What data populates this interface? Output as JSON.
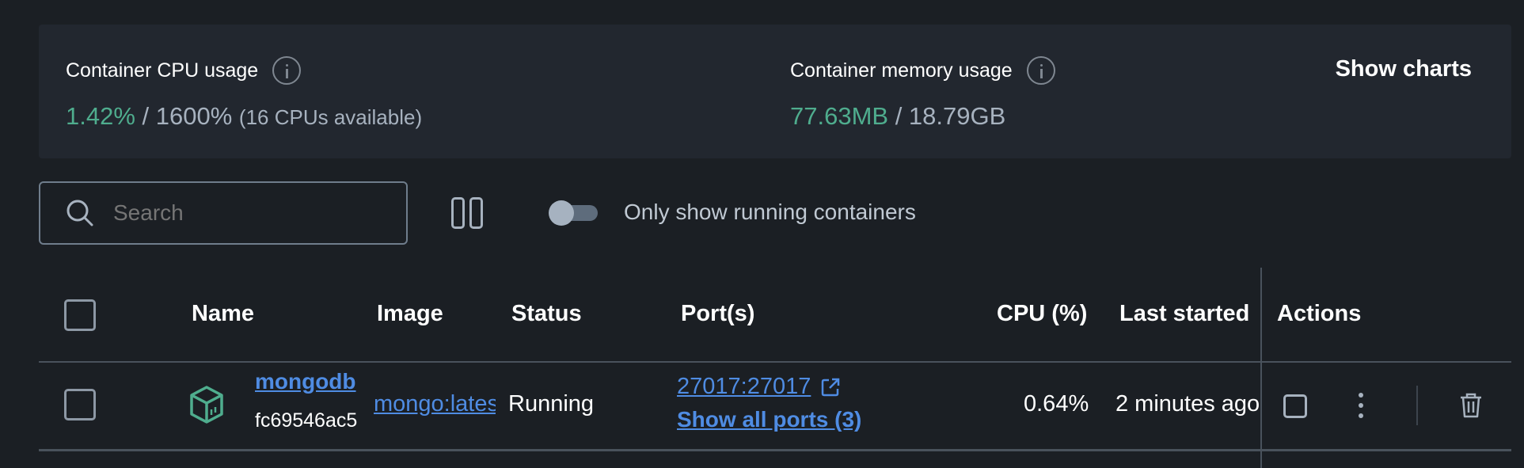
{
  "stats": {
    "cpu": {
      "label": "Container CPU usage",
      "used": "1.42%",
      "separator": " / ",
      "total": "1600%",
      "note": "(16 CPUs available)"
    },
    "memory": {
      "label": "Container memory usage",
      "used": "77.63MB",
      "separator": " / ",
      "total": "18.79GB"
    },
    "show_charts_label": "Show charts"
  },
  "toolbar": {
    "search_placeholder": "Search",
    "running_toggle_label": "Only show running containers",
    "running_toggle_on": false
  },
  "table": {
    "columns": [
      "Name",
      "Image",
      "Status",
      "Port(s)",
      "CPU (%)",
      "Last started",
      "Actions"
    ],
    "rows": [
      {
        "name": "mongodb",
        "id": "fc69546ac5",
        "image": "mongo:latest",
        "status": "Running",
        "port": "27017:27017",
        "all_ports": "Show all ports (3)",
        "cpu": "0.64%",
        "last_started": "2 minutes ago"
      }
    ]
  },
  "colors": {
    "background": "#1b1f24",
    "card": "#22272f",
    "accent_green": "#4fad8e",
    "link_blue": "#4f8ce3",
    "muted": "#a7b2bf"
  },
  "icons": {
    "info": "info-icon",
    "search": "search-icon",
    "columns": "columns-icon",
    "container": "container-icon",
    "external_link": "external-link-icon",
    "more": "more-vertical-icon",
    "delete": "trash-icon"
  }
}
